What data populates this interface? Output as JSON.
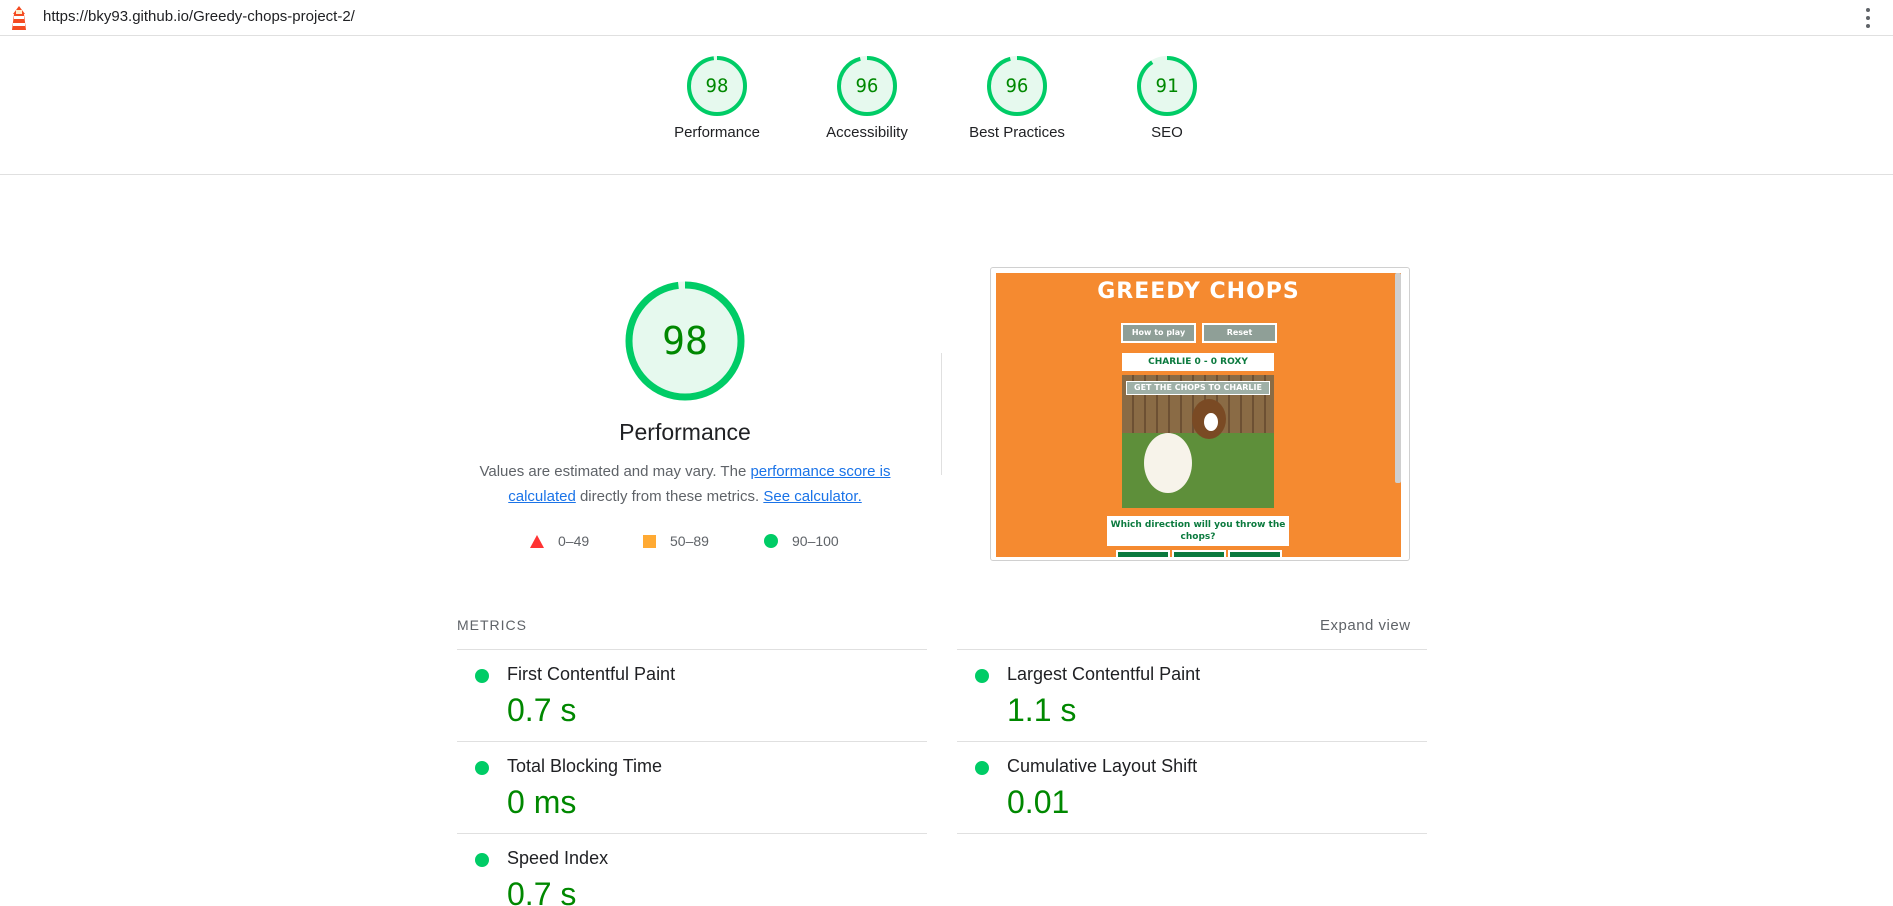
{
  "topbar": {
    "url": "https://bky93.github.io/Greedy-chops-project-2/",
    "menu_icon": "kebab-menu-icon",
    "logo_icon": "lighthouse-icon"
  },
  "categories": [
    {
      "score": 98,
      "label": "Performance"
    },
    {
      "score": 96,
      "label": "Accessibility"
    },
    {
      "score": 96,
      "label": "Best Practices"
    },
    {
      "score": 91,
      "label": "SEO"
    }
  ],
  "performance": {
    "score": 98,
    "title": "Performance",
    "desc_before": "Values are estimated and may vary. The ",
    "desc_link1": "performance score is calculated",
    "desc_middle": " directly from these metrics. ",
    "desc_link2": "See calculator.",
    "legend": [
      {
        "icon": "triangle-fail-icon",
        "range": "0–49",
        "color": "#ff3333"
      },
      {
        "icon": "square-average-icon",
        "range": "50–89",
        "color": "#ffaa33"
      },
      {
        "icon": "circle-pass-icon",
        "range": "90–100",
        "color": "#00cc66"
      }
    ]
  },
  "screenshot": {
    "title": "GREEDY CHOPS",
    "btn_how": "How to play",
    "btn_reset": "Reset",
    "score_text": "CHARLIE 0 - 0 ROXY",
    "banner": "GET THE CHOPS TO CHARLIE",
    "question": "Which direction will you throw the chops?"
  },
  "metrics": {
    "header": "METRICS",
    "expand": "Expand view",
    "items": [
      {
        "name": "First Contentful Paint",
        "value": "0.7 s"
      },
      {
        "name": "Largest Contentful Paint",
        "value": "1.1 s"
      },
      {
        "name": "Total Blocking Time",
        "value": "0 ms"
      },
      {
        "name": "Cumulative Layout Shift",
        "value": "0.01"
      },
      {
        "name": "Speed Index",
        "value": "0.7 s"
      }
    ]
  },
  "colors": {
    "pass": "#00cc66",
    "pass_fill": "#e6f9ee",
    "pass_text": "#008800",
    "link": "#1a73e8"
  }
}
